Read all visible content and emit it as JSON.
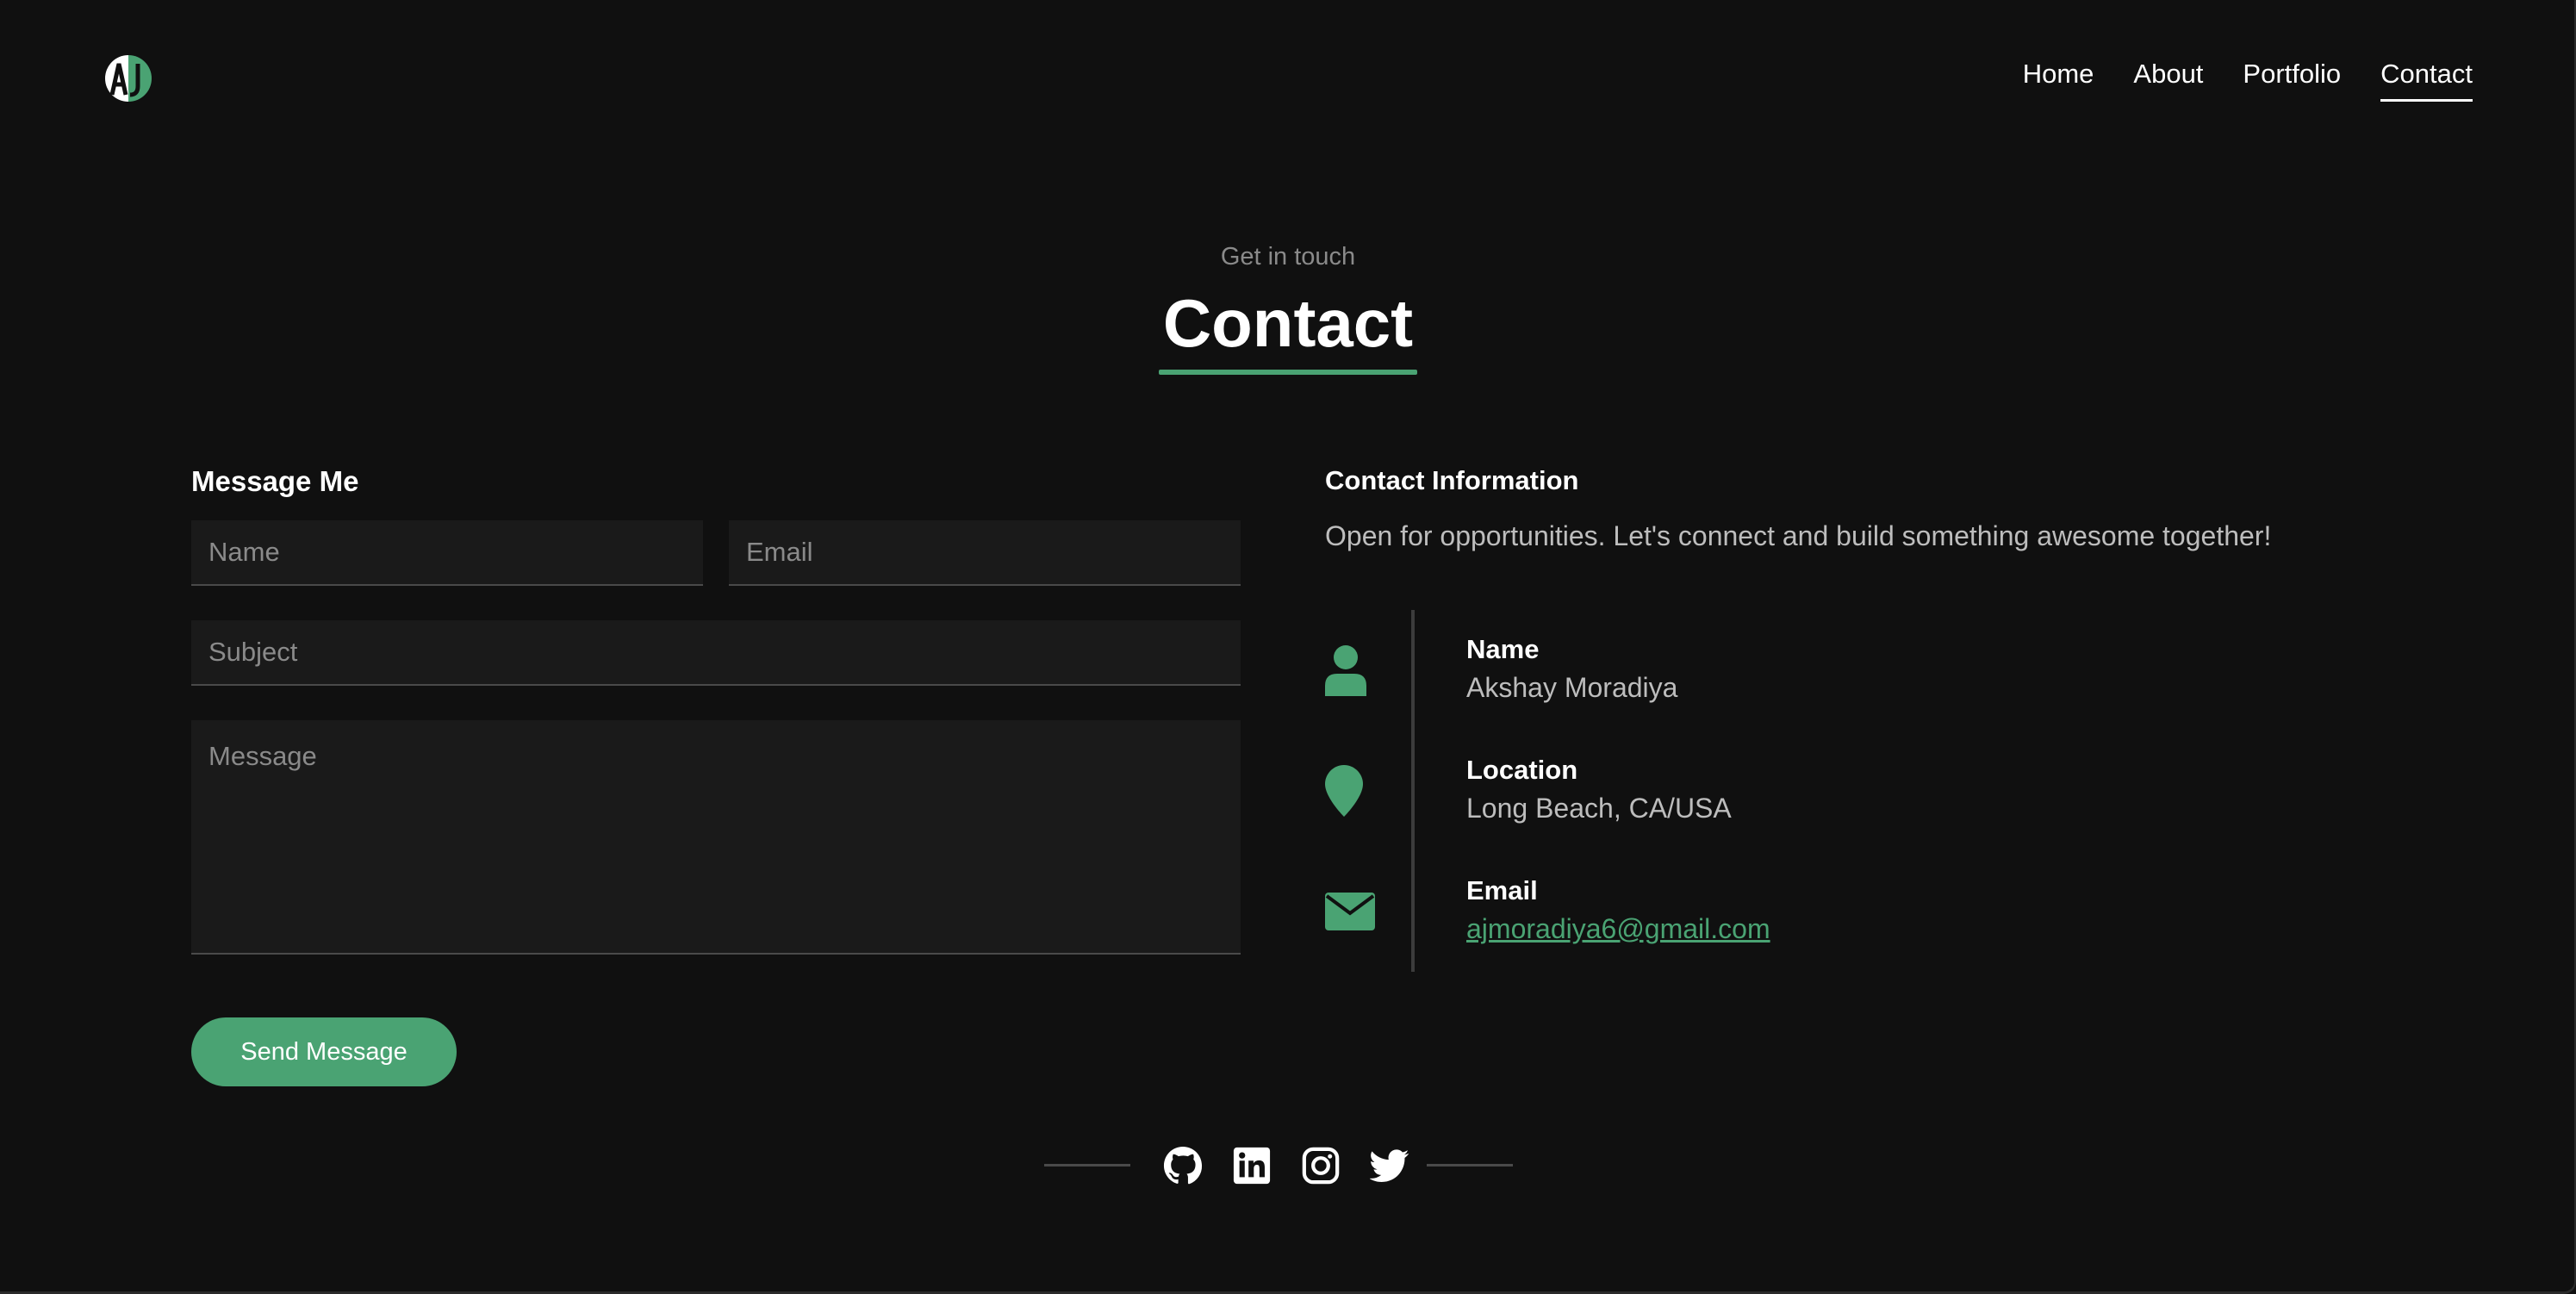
{
  "nav": {
    "logo_icon": "aj-monogram-icon",
    "items": [
      {
        "label": "Home"
      },
      {
        "label": "About"
      },
      {
        "label": "Portfolio"
      },
      {
        "label": "Contact",
        "active": true
      }
    ]
  },
  "hero": {
    "eyebrow": "Get in touch",
    "title": "Contact"
  },
  "form": {
    "title": "Message Me",
    "name_placeholder": "Name",
    "email_placeholder": "Email",
    "subject_placeholder": "Subject",
    "message_placeholder": "Message",
    "submit_label": "Send Message"
  },
  "info": {
    "title": "Contact Information",
    "description": "Open for opportunities. Let's connect and build something awesome together!",
    "items": [
      {
        "icon": "user-icon",
        "label": "Name",
        "value": "Akshay Moradiya"
      },
      {
        "icon": "location-pin-icon",
        "label": "Location",
        "value": "Long Beach, CA/USA"
      },
      {
        "icon": "envelope-icon",
        "label": "Email",
        "value": "ajmoradiya6@gmail.com"
      }
    ]
  },
  "social": [
    "github-icon",
    "linkedin-icon",
    "instagram-icon",
    "twitter-icon"
  ],
  "colors": {
    "background": "#101010",
    "accent": "#4aa373",
    "field_bg": "#1a1a1a",
    "muted_text": "#bdbdbd"
  }
}
